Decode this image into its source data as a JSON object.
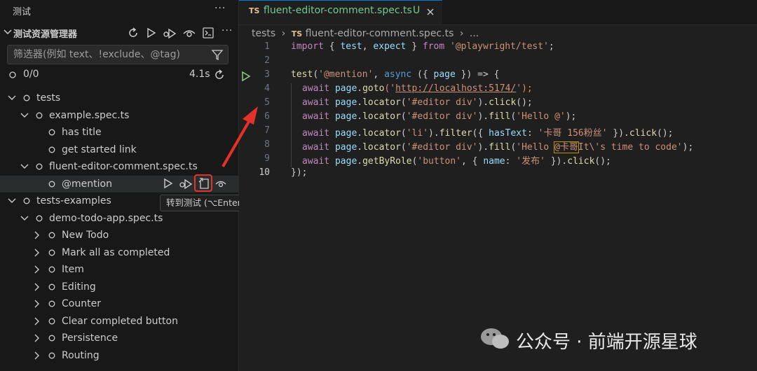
{
  "sidebar": {
    "title": "测试",
    "more_label": "···",
    "explorer_title": "测试资源管理器",
    "filter_placeholder": "筛选器(例如 text、!exclude、@tag)",
    "results": "0/0",
    "duration": "4.1s",
    "tree": [
      {
        "label": "tests",
        "depth": 0,
        "twisty": "down"
      },
      {
        "label": "example.spec.ts",
        "depth": 1,
        "twisty": "down"
      },
      {
        "label": "has title",
        "depth": 2,
        "twisty": "none"
      },
      {
        "label": "get started link",
        "depth": 2,
        "twisty": "none"
      },
      {
        "label": "fluent-editor-comment.spec.ts",
        "depth": 1,
        "twisty": "down"
      },
      {
        "label": "@mention",
        "depth": 2,
        "twisty": "none",
        "hover": true
      },
      {
        "label": "tests-examples",
        "depth": 0,
        "twisty": "down"
      },
      {
        "label": "demo-todo-app.spec.ts",
        "depth": 1,
        "twisty": "down"
      },
      {
        "label": "New Todo",
        "depth": 2,
        "twisty": "right"
      },
      {
        "label": "Mark all as completed",
        "depth": 2,
        "twisty": "right"
      },
      {
        "label": "Item",
        "depth": 2,
        "twisty": "right"
      },
      {
        "label": "Editing",
        "depth": 2,
        "twisty": "right"
      },
      {
        "label": "Counter",
        "depth": 2,
        "twisty": "right"
      },
      {
        "label": "Clear completed button",
        "depth": 2,
        "twisty": "right"
      },
      {
        "label": "Persistence",
        "depth": 2,
        "twisty": "right"
      },
      {
        "label": "Routing",
        "depth": 2,
        "twisty": "right"
      }
    ],
    "tooltip": "转到测试 (⌥Enter)"
  },
  "editor": {
    "tab": {
      "badge": "TS",
      "filename": "fluent-editor-comment.spec.ts",
      "status": "U"
    },
    "breadcrumb": {
      "folder": "tests",
      "badge": "TS",
      "file": "fluent-editor-comment.spec.ts",
      "tail": "..."
    },
    "line_numbers": [
      "1",
      "2",
      "3",
      "4",
      "5",
      "6",
      "7",
      "8",
      "9",
      "10"
    ],
    "active_line": "10",
    "lines": {
      "l1": {
        "a": "import",
        "b": " { ",
        "c": "test",
        "d": ", ",
        "e": "expect",
        "f": " } ",
        "g": "from",
        "h": " ",
        "i": "'@playwright/test'",
        "j": ";"
      },
      "l3": {
        "a": "test",
        "b": "(",
        "c": "'@mention'",
        "d": ", ",
        "e": "async",
        "f": " ({ ",
        "g": "page",
        "h": " }) => {"
      },
      "l4": {
        "a": "await",
        "b": " ",
        "c": "page",
        "d": ".",
        "e": "goto",
        "f": "('",
        "g": "http://localhost:5174/",
        "h": "');"
      },
      "l5": {
        "a": "await",
        "b": " ",
        "c": "page",
        "d": ".",
        "e": "locator",
        "f": "(",
        "g": "'#editor div'",
        "h": ").",
        "i": "click",
        "j": "();"
      },
      "l6": {
        "a": "await",
        "b": " ",
        "c": "page",
        "d": ".",
        "e": "locator",
        "f": "(",
        "g": "'#editor div'",
        "h": ").",
        "i": "fill",
        "j": "(",
        "k": "'Hello @'",
        "l": ");"
      },
      "l7": {
        "a": "await",
        "b": " ",
        "c": "page",
        "d": ".",
        "e": "locator",
        "f": "(",
        "g": "'li'",
        "h": ").",
        "i": "filter",
        "j": "({ ",
        "k": "hasText",
        "l": ": ",
        "m": "'卡哥 156粉丝'",
        "n": " }).",
        "o": "click",
        "p": "();"
      },
      "l8": {
        "a": "await",
        "b": " ",
        "c": "page",
        "d": ".",
        "e": "locator",
        "f": "(",
        "g": "'#editor div'",
        "h": ").",
        "i": "fill",
        "j": "(",
        "k": "'Hello ",
        "k2": "@卡哥",
        "k3": "It\\'s time to code'",
        "l": ");"
      },
      "l9": {
        "a": "await",
        "b": " ",
        "c": "page",
        "d": ".",
        "e": "getByRole",
        "f": "(",
        "g": "'button'",
        "h": ", { ",
        "i": "name",
        "j": ": ",
        "k": "'发布'",
        "l": " }).",
        "m": "click",
        "n": "();"
      },
      "l10": {
        "a": "});"
      }
    }
  },
  "watermark": "公众号 · 前端开源星球",
  "colors": {
    "accent": "#0078d4",
    "run_green": "#89d185",
    "highlight_red": "#e5312b",
    "keyword": "#569cd6",
    "control": "#c586c0",
    "string": "#ce9178",
    "function": "#dcdcaa",
    "variable": "#9cdcfe"
  }
}
